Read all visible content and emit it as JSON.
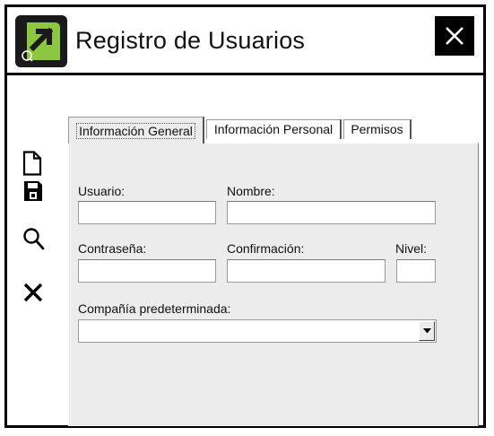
{
  "window": {
    "title": "Registro de Usuarios",
    "icon": "app-logo-icon",
    "close_icon": "close-icon"
  },
  "toolbar": [
    {
      "name": "new-document-icon"
    },
    {
      "name": "save-icon"
    },
    {
      "name": "search-icon"
    },
    {
      "name": "delete-icon"
    }
  ],
  "tabs": [
    {
      "label": "Información General",
      "active": true
    },
    {
      "label": "Información Personal",
      "active": false
    },
    {
      "label": "Permisos",
      "active": false
    }
  ],
  "form": {
    "usuario": {
      "label": "Usuario:",
      "value": ""
    },
    "nombre": {
      "label": "Nombre:",
      "value": ""
    },
    "contrasena": {
      "label": "Contraseña:",
      "value": ""
    },
    "confirmacion": {
      "label": "Confirmación:",
      "value": ""
    },
    "nivel": {
      "label": "Nivel:",
      "value": ""
    },
    "compania": {
      "label": "Compañía predeterminada:",
      "value": ""
    }
  },
  "colors": {
    "logo_green": "#8dc63f",
    "logo_dark": "#1a1a1a",
    "panel": "#ececec"
  }
}
